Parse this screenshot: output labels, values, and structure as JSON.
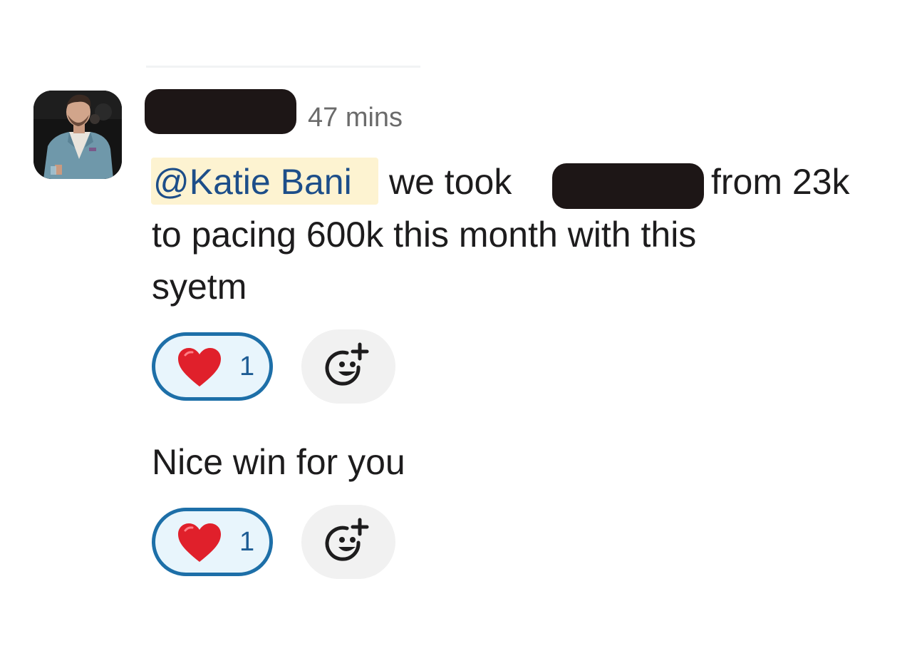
{
  "message": {
    "timestamp": "47 mins",
    "mention": "@Katie Bani",
    "line1_part1": "we took",
    "line1_part2": "from 23k",
    "line2": "to pacing 600k this month with this",
    "line3": "syetm"
  },
  "reply": {
    "text": "Nice win for you"
  },
  "reactions": [
    {
      "emoji": "heart-icon",
      "count": "1"
    },
    {
      "emoji": "heart-icon",
      "count": "1"
    }
  ],
  "colors": {
    "mention_text": "#1d4e89",
    "mention_bg": "#fdf3d1",
    "reaction_border": "#1d6fa8",
    "reaction_bg": "#e8f5fc",
    "redaction": "#1d1616"
  }
}
